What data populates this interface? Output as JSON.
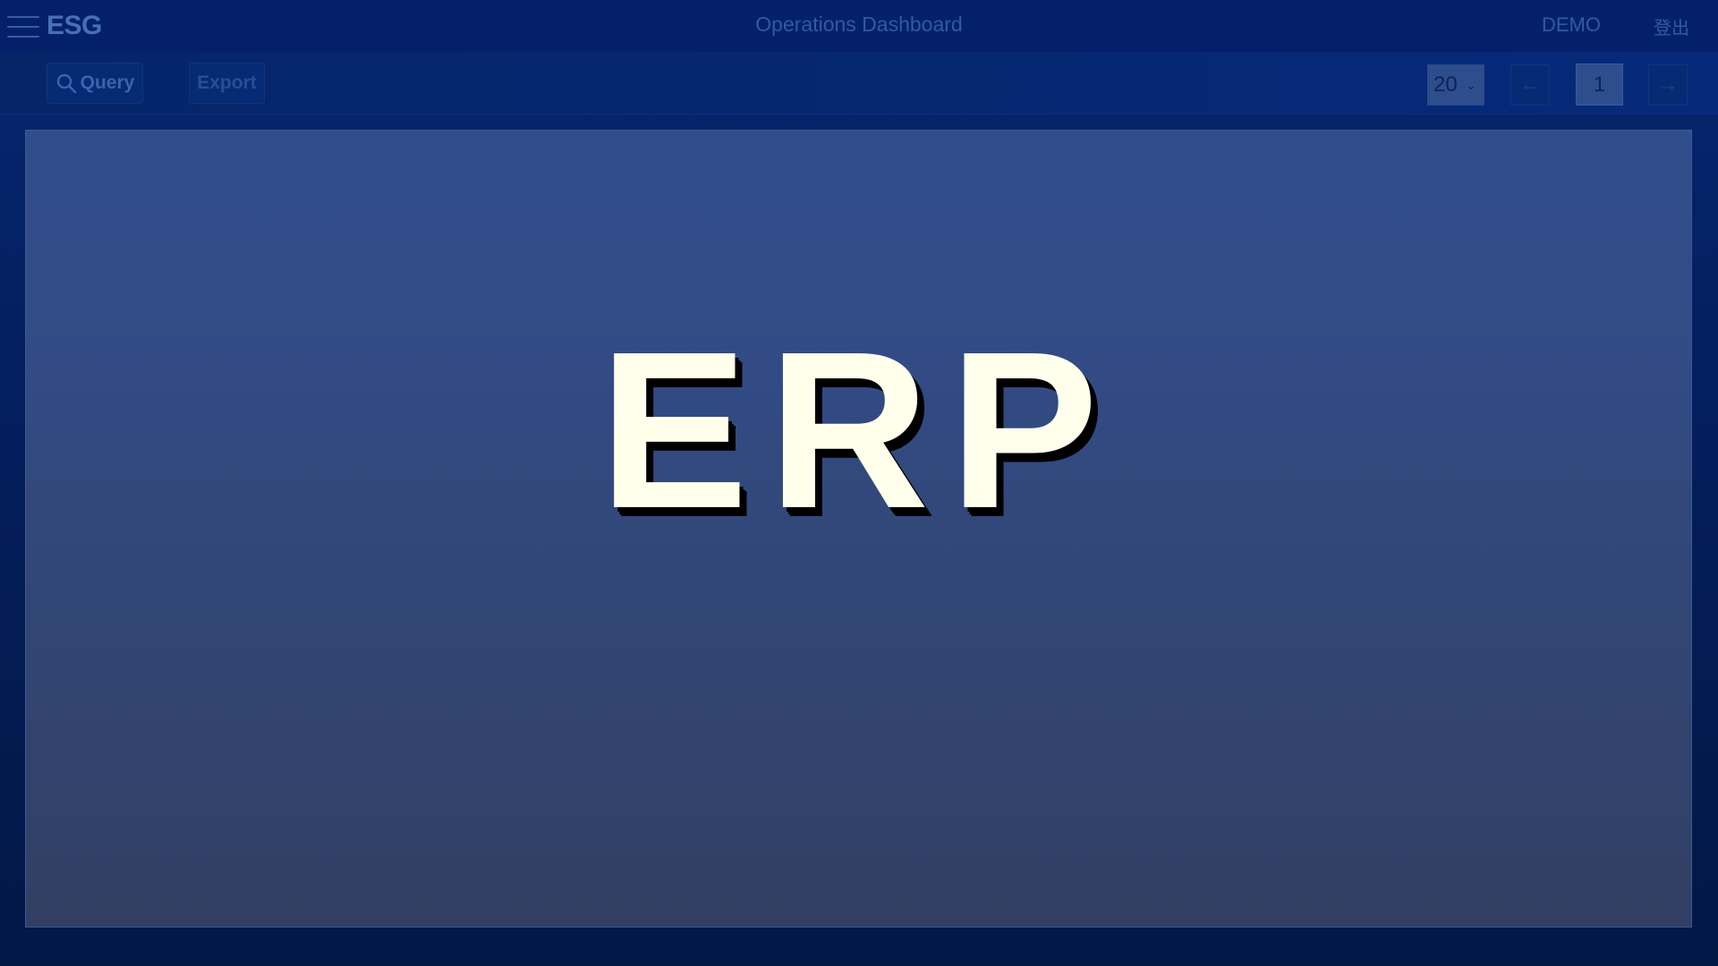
{
  "header": {
    "logo": "ESG",
    "title": "Operations Dashboard",
    "user": "DEMO",
    "logout_label": "登出"
  },
  "toolbar": {
    "query_label": "Query",
    "export_label": "Export",
    "page_size": "20",
    "prev_label": "←",
    "current_page": "1",
    "next_label": "→"
  },
  "main": {
    "splash_text": "ERP"
  },
  "colors": {
    "header_bg": "#05206a",
    "panel_top": "#314e8c",
    "panel_bottom": "#323f63",
    "splash_text": "#ffffec"
  }
}
